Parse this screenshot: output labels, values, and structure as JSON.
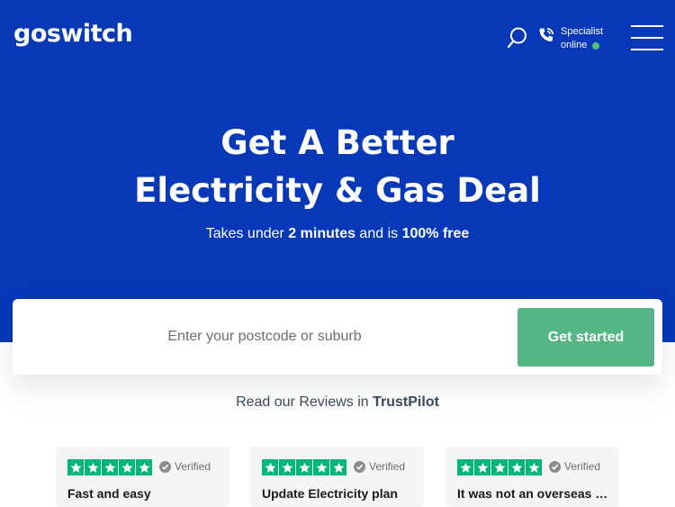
{
  "header": {
    "logo_text": "goswitch",
    "specialist_label": "Specialist",
    "online_label": "online",
    "online_color": "#4cc27a",
    "icons": [
      "search-icon",
      "phone-icon",
      "hamburger-menu-icon"
    ]
  },
  "hero": {
    "headline_line1": "Get A Better",
    "headline_line2": "Electricity & Gas Deal",
    "sub_part1": "Takes under ",
    "sub_bold1": "2 minutes",
    "sub_part2": " and is ",
    "sub_bold2": "100% free",
    "background_color": "#0638b8"
  },
  "search": {
    "placeholder": "Enter your postcode or suburb",
    "value": "",
    "button_label": "Get started",
    "button_color": "#56b683"
  },
  "reviews": {
    "heading_prefix": "Read our Reviews in ",
    "heading_brand": "TrustPilot",
    "star_color": "#00b67a",
    "cards": [
      {
        "rating": 5,
        "verified_label": "Verified",
        "title": "Fast and easy"
      },
      {
        "rating": 5,
        "verified_label": "Verified",
        "title": "Update Electricity plan"
      },
      {
        "rating": 5,
        "verified_label": "Verified",
        "title": "It was not an overseas o..."
      }
    ]
  }
}
